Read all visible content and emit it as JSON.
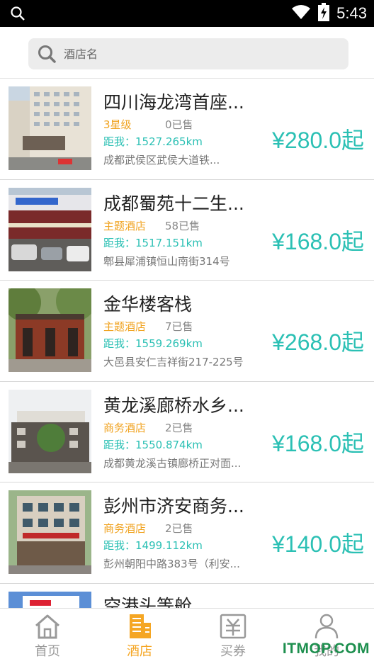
{
  "status_bar": {
    "time": "5:43"
  },
  "search": {
    "placeholder": "酒店名"
  },
  "hotels": [
    {
      "name": "四川海龙湾首座...",
      "type": "3星级",
      "sold": "0已售",
      "distance": "距我：1527.265km",
      "address": "成都武侯区武侯大道铁...",
      "price": "¥280.0起"
    },
    {
      "name": "成都蜀苑十二生...",
      "type": "主题酒店",
      "sold": "58已售",
      "distance": "距我：1517.151km",
      "address": "郫县犀浦镇恒山南街314号",
      "price": "¥168.0起"
    },
    {
      "name": "金华楼客栈",
      "type": "主题酒店",
      "sold": "7已售",
      "distance": "距我：1559.269km",
      "address": "大邑县安仁吉祥街217-225号",
      "price": "¥268.0起"
    },
    {
      "name": "黄龙溪廊桥水乡...",
      "type": "商务酒店",
      "sold": "2已售",
      "distance": "距我：1550.874km",
      "address": "成都黄龙溪古镇廊桥正对面...",
      "price": "¥168.0起"
    },
    {
      "name": "彭州市济安商务...",
      "type": "商务酒店",
      "sold": "2已售",
      "distance": "距我：1499.112km",
      "address": "彭州朝阳中路383号（利安...",
      "price": "¥140.0起"
    }
  ],
  "partial_hotel": {
    "name": "空港头等舱"
  },
  "tabs": [
    {
      "label": "首页",
      "icon": "home-icon"
    },
    {
      "label": "酒店",
      "icon": "hotel-icon",
      "active": true
    },
    {
      "label": "买券",
      "icon": "coupon-icon"
    },
    {
      "label": "我的",
      "icon": "person-icon"
    }
  ],
  "watermark": "ITMOP.COM",
  "colors": {
    "accent": "#2bc0b4",
    "type_tag": "#f0a21e",
    "active_tab": "#f5a623"
  }
}
